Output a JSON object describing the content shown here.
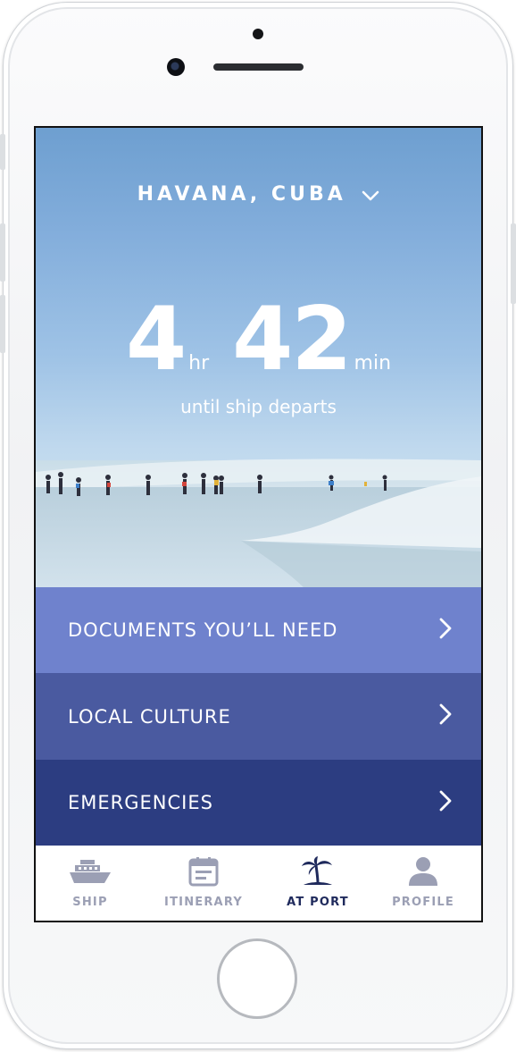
{
  "location": {
    "name": "HAVANA, CUBA",
    "dropdown_icon": "chevron-down-icon"
  },
  "countdown": {
    "hours": "4",
    "hours_unit": "hr",
    "minutes": "42",
    "minutes_unit": "min",
    "caption": "until ship departs"
  },
  "menu": [
    {
      "label": "DOCUMENTS YOU’LL NEED",
      "color": "#6f82cd"
    },
    {
      "label": "LOCAL CULTURE",
      "color": "#4a5aa0"
    },
    {
      "label": "EMERGENCIES",
      "color": "#2c3d81"
    }
  ],
  "tabs": [
    {
      "label": "SHIP",
      "icon": "ship-icon",
      "active": false
    },
    {
      "label": "ITINERARY",
      "icon": "calendar-icon",
      "active": false
    },
    {
      "label": "AT PORT",
      "icon": "palm-tree-icon",
      "active": true
    },
    {
      "label": "PROFILE",
      "icon": "person-icon",
      "active": false
    }
  ],
  "colors": {
    "tab_inactive": "#9b9fb4",
    "tab_active": "#1f2a5c"
  }
}
